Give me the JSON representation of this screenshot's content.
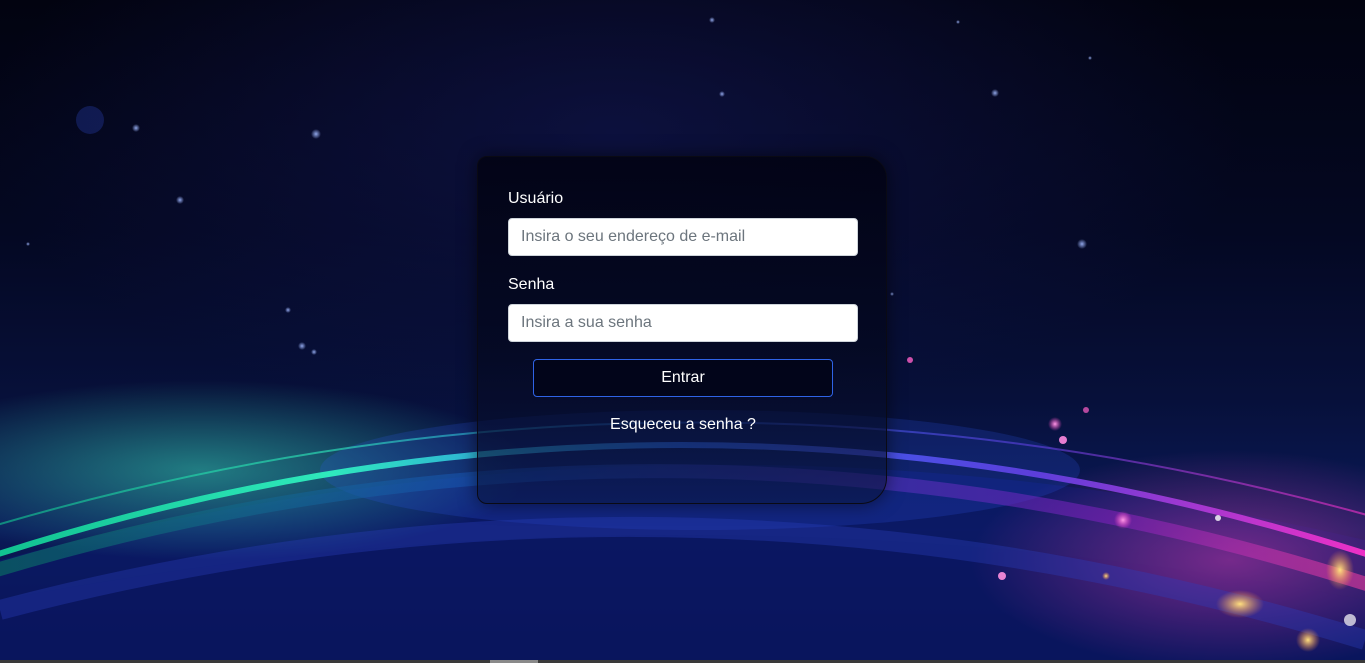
{
  "login": {
    "username_label": "Usuário",
    "username_placeholder": "Insira o seu endereço de e-mail",
    "password_label": "Senha",
    "password_placeholder": "Insira a sua senha",
    "submit_label": "Entrar",
    "forgot_label": "Esqueceu a senha ?"
  },
  "colors": {
    "button_border": "#2f63e6",
    "text": "#ffffff",
    "glow_green": "#22e0a0",
    "glow_magenta": "#e030c0"
  }
}
